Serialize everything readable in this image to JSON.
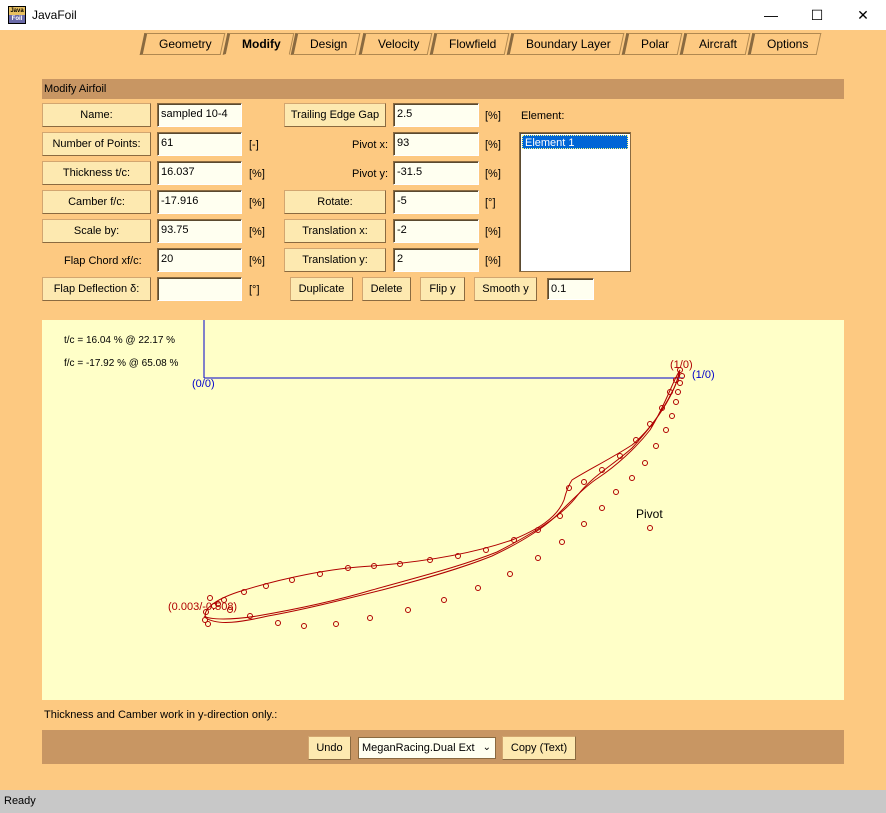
{
  "window": {
    "title": "JavaFoil",
    "icon_top": "Java",
    "icon_bottom": "Foil"
  },
  "controls": {
    "minimize": "—",
    "maximize": "☐",
    "close": "✕"
  },
  "tabs": [
    {
      "label": "Geometry"
    },
    {
      "label": "Modify"
    },
    {
      "label": "Design"
    },
    {
      "label": "Velocity"
    },
    {
      "label": "Flowfield"
    },
    {
      "label": "Boundary Layer"
    },
    {
      "label": "Polar"
    },
    {
      "label": "Aircraft"
    },
    {
      "label": "Options"
    }
  ],
  "active_tab": "Modify",
  "section": {
    "title": "Modify Airfoil"
  },
  "left": {
    "name_btn": "Name:",
    "name_val": "sampled 10-4",
    "points_btn": "Number of Points:",
    "points_val": "61",
    "points_unit": "[-]",
    "thickness_btn": "Thickness  t/c:",
    "thickness_val": "16.037",
    "thickness_unit": "[%]",
    "camber_btn": "Camber  f/c:",
    "camber_val": "-17.916",
    "camber_unit": "[%]",
    "scale_btn": "Scale by:",
    "scale_val": "93.75",
    "scale_unit": "[%]",
    "flapchord_label": "Flap Chord    xf/c:",
    "flapchord_val": "20",
    "flapchord_unit": "[%]",
    "flapdefl_btn": "Flap Deflection   δ:",
    "flapdefl_val": "",
    "flapdefl_unit": "[°]"
  },
  "middle": {
    "te_gap_btn": "Trailing Edge Gap",
    "te_gap_val": "2.5",
    "te_gap_unit": "[%]",
    "pivot_x_label": "Pivot x:",
    "pivot_x_val": "93",
    "pivot_x_unit": "[%]",
    "pivot_y_label": "Pivot y:",
    "pivot_y_val": "-31.5",
    "pivot_y_unit": "[%]",
    "rotate_btn": "Rotate:",
    "rotate_val": "-5",
    "rotate_unit": "[°]",
    "trans_x_btn": "Translation x:",
    "trans_x_val": "-2",
    "trans_x_unit": "[%]",
    "trans_y_btn": "Translation y:",
    "trans_y_val": "2",
    "trans_y_unit": "[%]"
  },
  "actions": {
    "duplicate": "Duplicate",
    "delete": "Delete",
    "flip_y": "Flip y",
    "smooth_y": "Smooth y",
    "smooth_val": "0.1"
  },
  "element": {
    "label": "Element:",
    "items": [
      "Element 1"
    ]
  },
  "plot": {
    "thickness_info": "t/c = 16.04 % @ 22.17 %",
    "camber_info": "f/c = -17.92 % @ 65.08 %",
    "origin_label": "(0/0)",
    "te_label_axis": "(1/0)",
    "te_label_foil": "(1/0)",
    "le_label": "(0.003/-0.508)",
    "pivot_label": "Pivot",
    "axis_color": "#0000cc",
    "foil_color": "#b00000"
  },
  "note": "Thickness and Camber work in y-direction only.:",
  "bottom": {
    "undo": "Undo",
    "format_selected": "MeganRacing.Dual Ext",
    "copy": "Copy (Text)"
  },
  "status": "Ready"
}
